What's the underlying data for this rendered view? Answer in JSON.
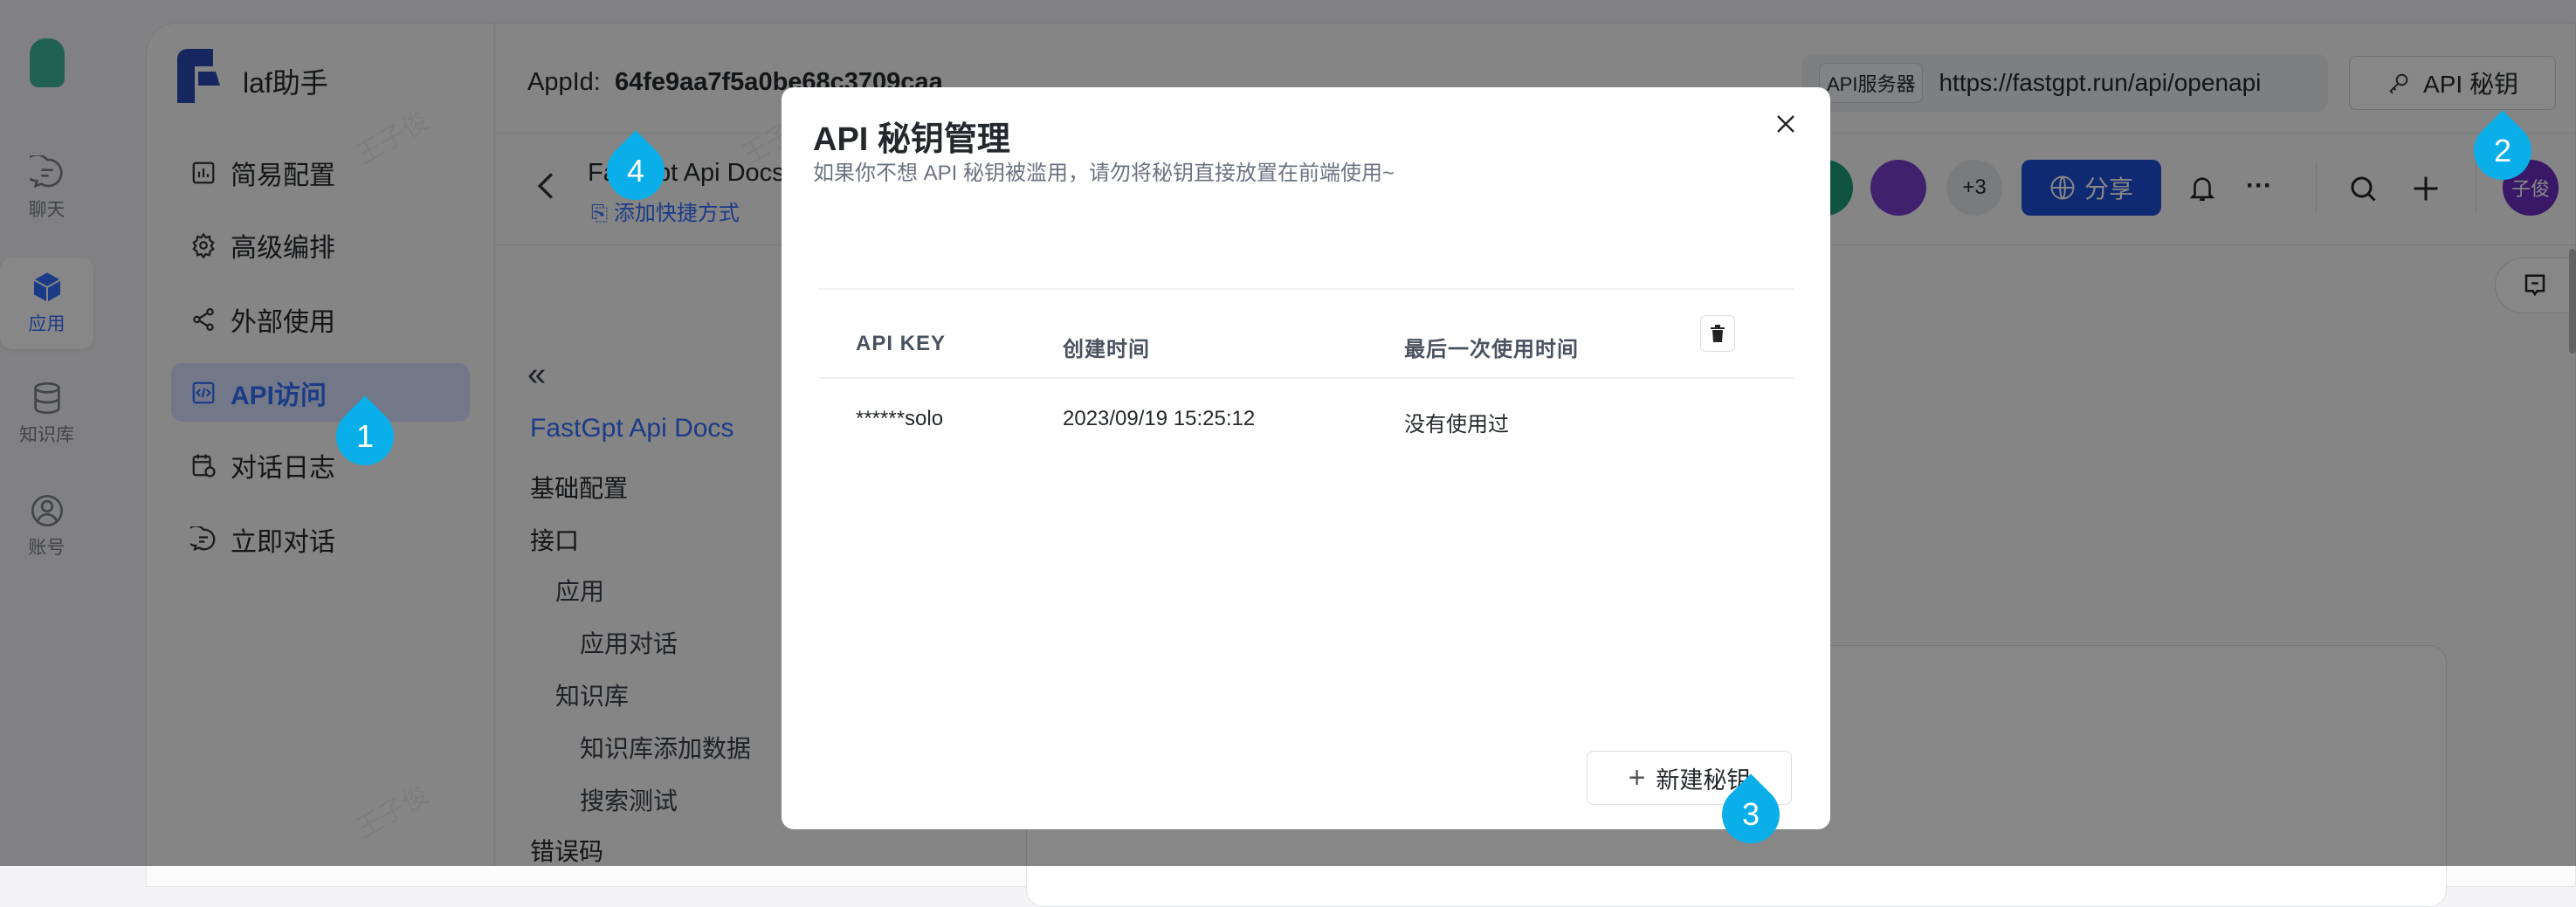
{
  "rail": {
    "items": [
      {
        "label": "聊天",
        "icon": "chat-icon"
      },
      {
        "label": "应用",
        "icon": "cube-icon",
        "active": true
      },
      {
        "label": "知识库",
        "icon": "database-icon"
      },
      {
        "label": "账号",
        "icon": "user-icon"
      }
    ]
  },
  "app": {
    "name": "laf助手"
  },
  "sidebar": {
    "items": [
      {
        "label": "简易配置"
      },
      {
        "label": "高级编排"
      },
      {
        "label": "外部使用"
      },
      {
        "label": "API访问",
        "active": true
      },
      {
        "label": "对话日志"
      },
      {
        "label": "立即对话"
      }
    ]
  },
  "header": {
    "appid_label": "AppId:",
    "appid_value": "64fe9aa7f5a0be68c3709caa",
    "server_tag": "API服务器",
    "server_url": "https://fastgpt.run/api/openapi",
    "api_key_button": "API 秘钥"
  },
  "subbar": {
    "title": "FastGpt Api Docs",
    "shortcut": "添加快捷方式",
    "more_avatars": "+3",
    "share": "分享",
    "user_avatar": "子俊"
  },
  "docs": {
    "collapse": "«",
    "title": "FastGpt Api Docs",
    "items": [
      {
        "label": "基础配置",
        "level": 0
      },
      {
        "label": "接口",
        "level": 0
      },
      {
        "label": "应用",
        "level": 1
      },
      {
        "label": "应用对话",
        "level": 2
      },
      {
        "label": "知识库",
        "level": 1
      },
      {
        "label": "知识库添加数据",
        "level": 2
      },
      {
        "label": "搜索测试",
        "level": 2
      },
      {
        "label": "错误码",
        "level": 0
      }
    ]
  },
  "modal": {
    "title": "API 秘钥管理",
    "subtitle": "如果你不想 API 秘钥被滥用，请勿将秘钥直接放置在前端使用~",
    "columns": [
      "API KEY",
      "创建时间",
      "最后一次使用时间"
    ],
    "rows": [
      {
        "key": "******solo",
        "created": "2023/09/19 15:25:12",
        "last_used": "没有使用过"
      }
    ],
    "new_button": "新建秘钥"
  },
  "markers": [
    "1",
    "2",
    "3",
    "4"
  ],
  "watermark": "王子俊",
  "colors": {
    "accent": "#3370ff",
    "marker": "#0aaee8",
    "share": "#1d4ed8"
  }
}
